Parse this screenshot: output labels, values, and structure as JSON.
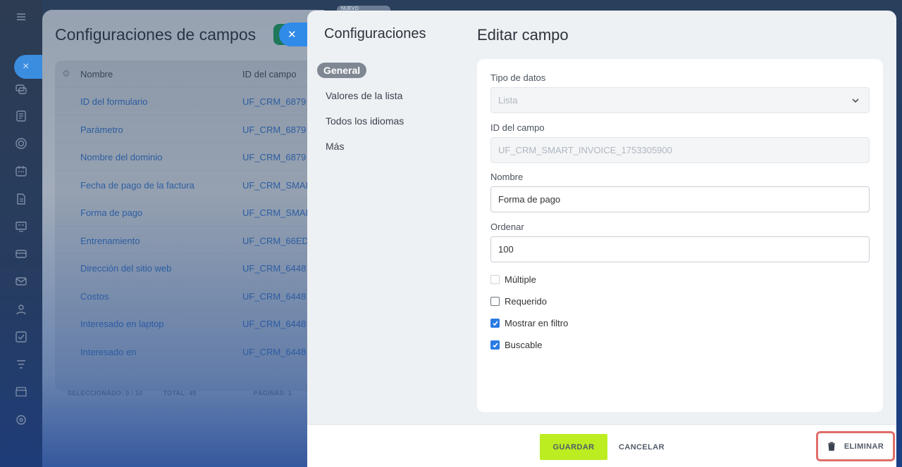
{
  "background_page": {
    "title": "Configuraciones de campos",
    "columns": [
      "Nombre",
      "ID del campo"
    ],
    "rows": [
      {
        "name": "ID del formulario",
        "id": "UF_CRM_6879"
      },
      {
        "name": "Parámetro",
        "id": "UF_CRM_6879"
      },
      {
        "name": "Nombre del dominio",
        "id": "UF_CRM_6879"
      },
      {
        "name": "Fecha de pago de la factura",
        "id": "UF_CRM_SMAR"
      },
      {
        "name": "Forma de pago",
        "id": "UF_CRM_SMAR"
      },
      {
        "name": "Entrenamiento",
        "id": "UF_CRM_66ED"
      },
      {
        "name": "Dirección del sitio web",
        "id": "UF_CRM_6448"
      },
      {
        "name": "Costos",
        "id": "UF_CRM_6448"
      },
      {
        "name": "Interesado en laptop",
        "id": "UF_CRM_6448"
      },
      {
        "name": "Interesado en",
        "id": "UF_CRM_6448"
      }
    ],
    "footer": {
      "selected": "SELECCIONADO: 0 / 10",
      "total": "TOTAL: 49",
      "pages": "PÁGINAS: 1"
    },
    "new_tab_label": "NUEVO"
  },
  "sidebar": {
    "title": "Configuraciones",
    "items": [
      {
        "label": "General",
        "active": true
      },
      {
        "label": "Valores de la lista",
        "active": false
      },
      {
        "label": "Todos los idiomas",
        "active": false
      },
      {
        "label": "Más",
        "active": false
      }
    ]
  },
  "main": {
    "title": "Editar campo",
    "fields": {
      "data_type": {
        "label": "Tipo de datos",
        "value": "Lista"
      },
      "field_id": {
        "label": "ID del campo",
        "value": "UF_CRM_SMART_INVOICE_1753305900"
      },
      "name": {
        "label": "Nombre",
        "value": "Forma de pago"
      },
      "sort": {
        "label": "Ordenar",
        "value": "100"
      }
    },
    "checkboxes": [
      {
        "label": "Múltiple",
        "checked": false,
        "disabled": true
      },
      {
        "label": "Requerido",
        "checked": false,
        "disabled": false
      },
      {
        "label": "Mostrar en filtro",
        "checked": true,
        "disabled": false
      },
      {
        "label": "Buscable",
        "checked": true,
        "disabled": false
      }
    ]
  },
  "footer": {
    "save_label": "GUARDAR",
    "cancel_label": "CANCELAR",
    "delete_label": "ELIMINAR"
  },
  "colors": {
    "save_button": "#bbed21",
    "checkbox_checked": "#2b7be3",
    "delete_highlight": "#e06d6a"
  }
}
